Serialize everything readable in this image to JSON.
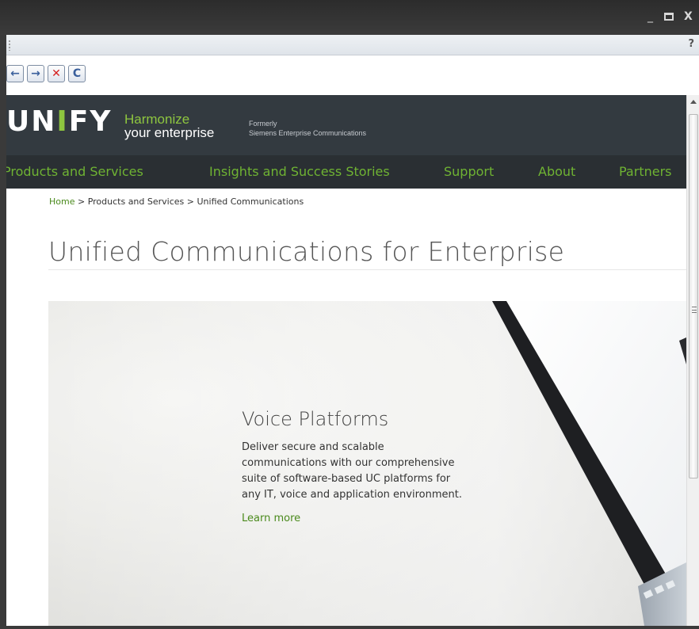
{
  "window": {
    "minimize_glyph": "_",
    "close_glyph": "X",
    "help_glyph": "?"
  },
  "toolbar": {
    "back_icon": "←",
    "forward_icon": "→",
    "stop_icon": "✕",
    "refresh_icon": "C"
  },
  "header": {
    "logo_part1": "UN",
    "logo_accent": "I",
    "logo_part2": "FY",
    "tagline_line1": "Harmonize",
    "tagline_line2": "your enterprise",
    "formerly_line1": "Formerly",
    "formerly_line2": "Siemens Enterprise Communications"
  },
  "nav": {
    "items": [
      {
        "label": "Products and Services"
      },
      {
        "label": "Insights and Success Stories"
      },
      {
        "label": "Support"
      },
      {
        "label": "About"
      },
      {
        "label": "Partners"
      }
    ]
  },
  "breadcrumb": {
    "home": "Home",
    "separator": ">",
    "level1": "Products and Services",
    "level2": "Unified Communications"
  },
  "main": {
    "title": "Unified Communications for Enterprise",
    "hero": {
      "title": "Voice Platforms",
      "description": "Deliver secure and scalable communications with our comprehensive suite of software-based UC platforms for any IT, voice and application environment.",
      "link": "Learn more"
    }
  },
  "colors": {
    "brand_green": "#8ec63f",
    "nav_green": "#6fb333",
    "link_green": "#4a8a1c",
    "header_bg": "#333a40",
    "nav_bg": "#2a2f33"
  }
}
